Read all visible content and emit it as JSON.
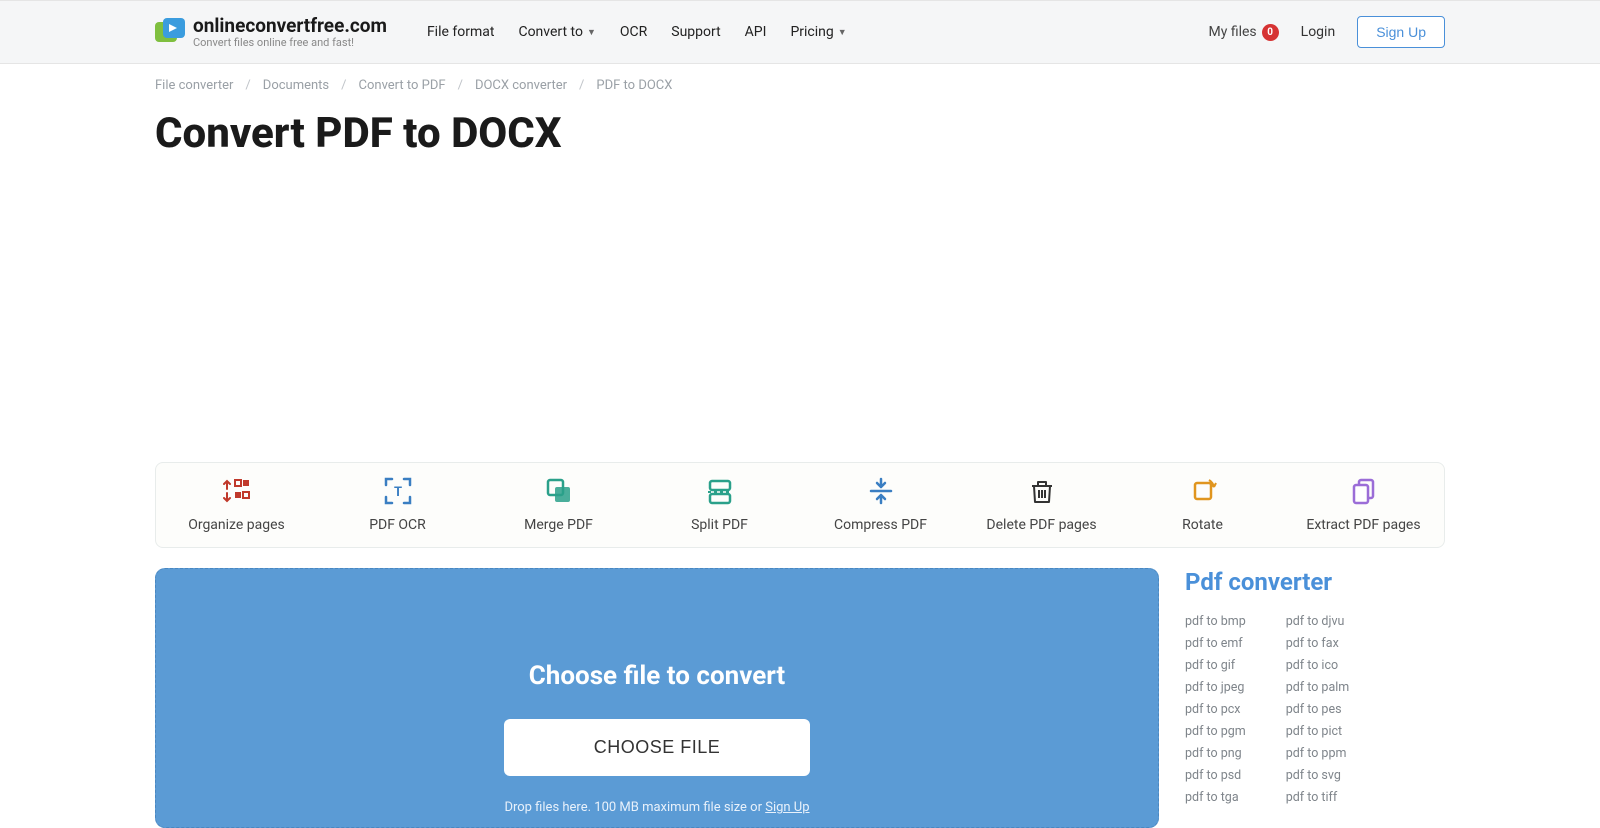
{
  "header": {
    "logo_title": "onlineconvertfree.com",
    "logo_sub": "Convert files online free and fast!",
    "nav": [
      {
        "label": "File format",
        "dropdown": false
      },
      {
        "label": "Convert to",
        "dropdown": true
      },
      {
        "label": "OCR",
        "dropdown": false
      },
      {
        "label": "Support",
        "dropdown": false
      },
      {
        "label": "API",
        "dropdown": false
      },
      {
        "label": "Pricing",
        "dropdown": true
      }
    ],
    "myfiles_label": "My files",
    "myfiles_count": "0",
    "login": "Login",
    "signup": "Sign Up"
  },
  "breadcrumbs": [
    "File converter",
    "Documents",
    "Convert to PDF",
    "DOCX converter",
    "PDF to DOCX"
  ],
  "page_title": "Convert PDF to DOCX",
  "tools": [
    {
      "label": "Organize pages"
    },
    {
      "label": "PDF OCR"
    },
    {
      "label": "Merge PDF"
    },
    {
      "label": "Split PDF"
    },
    {
      "label": "Compress PDF"
    },
    {
      "label": "Delete PDF pages"
    },
    {
      "label": "Rotate"
    },
    {
      "label": "Extract PDF pages"
    }
  ],
  "dropzone": {
    "title": "Choose file to convert",
    "button": "CHOOSE FILE",
    "hint_prefix": "Drop files here. 100 MB maximum file size or ",
    "hint_link": "Sign Up"
  },
  "sidebar": {
    "title": "Pdf converter",
    "col1": [
      "pdf to bmp",
      "pdf to emf",
      "pdf to gif",
      "pdf to jpeg",
      "pdf to pcx",
      "pdf to pgm",
      "pdf to png",
      "pdf to psd",
      "pdf to tga"
    ],
    "col2": [
      "pdf to djvu",
      "pdf to fax",
      "pdf to ico",
      "pdf to palm",
      "pdf to pes",
      "pdf to pict",
      "pdf to ppm",
      "pdf to svg",
      "pdf to tiff"
    ]
  },
  "colors": {
    "accent": "#4a90d9",
    "dropzone": "#5b9bd5",
    "badge": "#d63333"
  }
}
